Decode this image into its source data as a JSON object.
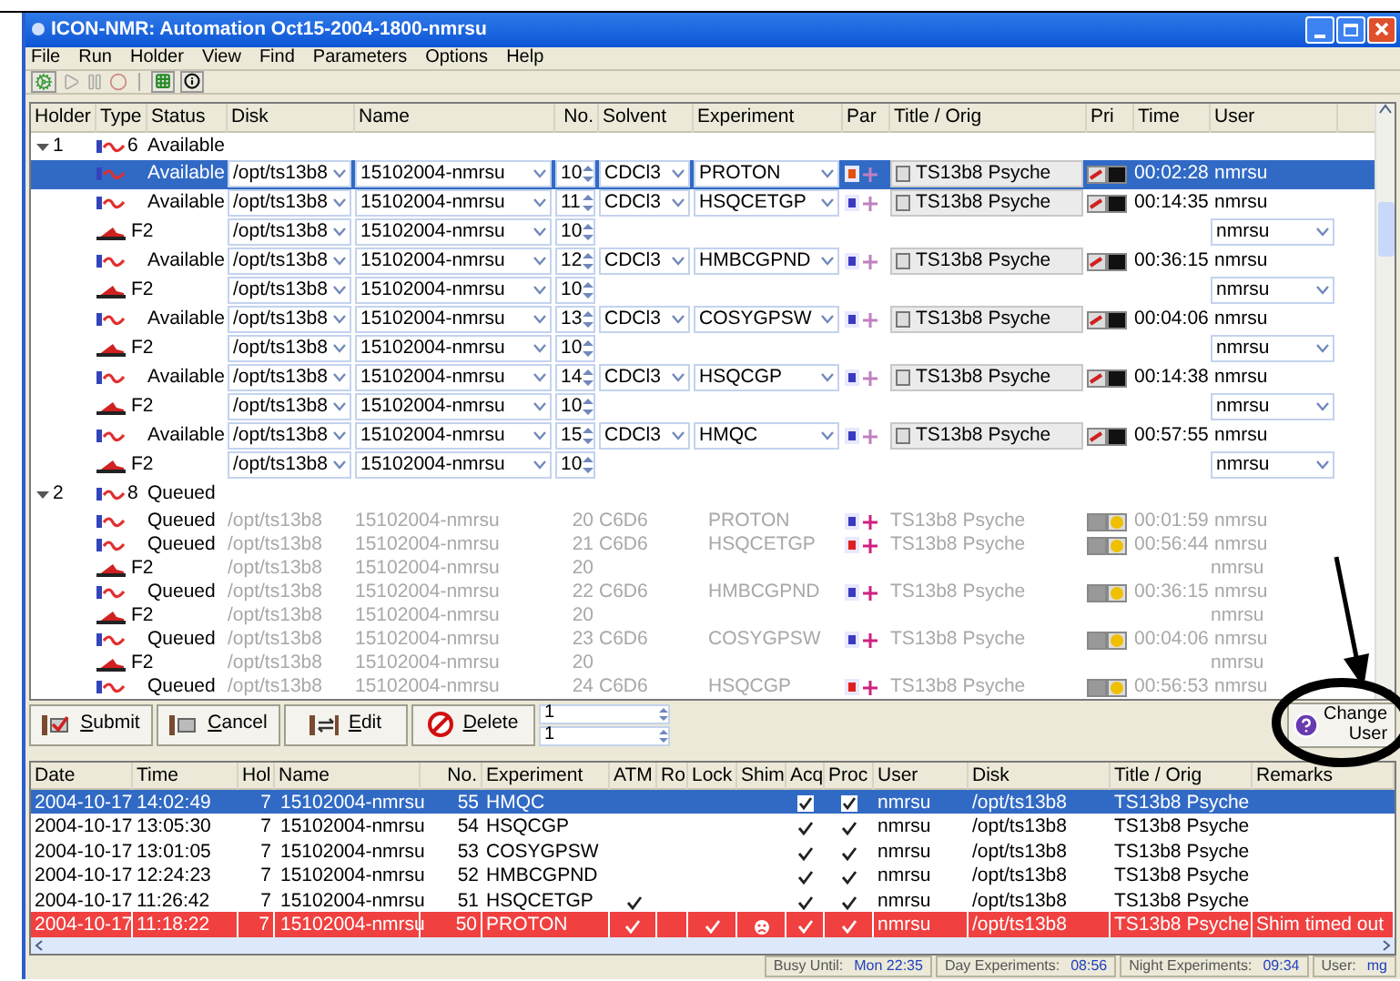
{
  "window": {
    "title": "ICON-NMR: Automation Oct15-2004-1800-nmrsu"
  },
  "menu": [
    "File",
    "Run",
    "Holder",
    "View",
    "Find",
    "Parameters",
    "Options",
    "Help"
  ],
  "queue": {
    "columns": [
      "Holder",
      "Type",
      "Status",
      "Disk",
      "Name",
      "No.",
      "Solvent",
      "Experiment",
      "Par",
      "Title / Orig",
      "Pri",
      "Time",
      "User"
    ],
    "groups": [
      {
        "holder": "1",
        "count": "6",
        "status": "Available",
        "expanded": true,
        "children": [
          {
            "kind": "experiment",
            "editable": true,
            "selected": true,
            "status": "Available",
            "disk": "/opt/ts13b8",
            "name": "15102004-nmrsu",
            "no": "10",
            "solvent": "CDCl3",
            "experiment": "PROTON",
            "color": "#e05010",
            "title": "TS13b8 Psyche",
            "time": "00:02:28",
            "user": "nmrsu"
          },
          {
            "kind": "experiment",
            "editable": true,
            "selected": false,
            "status": "Available",
            "disk": "/opt/ts13b8",
            "name": "15102004-nmrsu",
            "no": "11",
            "solvent": "CDCl3",
            "experiment": "HSQCETGP",
            "color": "#3a3ac0",
            "title": "TS13b8 Psyche",
            "time": "00:14:35",
            "user": "nmrsu"
          },
          {
            "kind": "parameter",
            "editable": true,
            "selected": false,
            "label": "F2",
            "disk": "/opt/ts13b8",
            "name": "15102004-nmrsu",
            "no": "10",
            "user": "nmrsu"
          },
          {
            "kind": "experiment",
            "editable": true,
            "selected": false,
            "status": "Available",
            "disk": "/opt/ts13b8",
            "name": "15102004-nmrsu",
            "no": "12",
            "solvent": "CDCl3",
            "experiment": "HMBCGPND",
            "color": "#3a3ac0",
            "title": "TS13b8 Psyche",
            "time": "00:36:15",
            "user": "nmrsu"
          },
          {
            "kind": "parameter",
            "editable": true,
            "selected": false,
            "label": "F2",
            "disk": "/opt/ts13b8",
            "name": "15102004-nmrsu",
            "no": "10",
            "user": "nmrsu"
          },
          {
            "kind": "experiment",
            "editable": true,
            "selected": false,
            "status": "Available",
            "disk": "/opt/ts13b8",
            "name": "15102004-nmrsu",
            "no": "13",
            "solvent": "CDCl3",
            "experiment": "COSYGPSW",
            "color": "#3a3ac0",
            "title": "TS13b8 Psyche",
            "time": "00:04:06",
            "user": "nmrsu"
          },
          {
            "kind": "parameter",
            "editable": true,
            "selected": false,
            "label": "F2",
            "disk": "/opt/ts13b8",
            "name": "15102004-nmrsu",
            "no": "10",
            "user": "nmrsu"
          },
          {
            "kind": "experiment",
            "editable": true,
            "selected": false,
            "status": "Available",
            "disk": "/opt/ts13b8",
            "name": "15102004-nmrsu",
            "no": "14",
            "solvent": "CDCl3",
            "experiment": "HSQCGP",
            "color": "#3a3ac0",
            "title": "TS13b8 Psyche",
            "time": "00:14:38",
            "user": "nmrsu"
          },
          {
            "kind": "parameter",
            "editable": true,
            "selected": false,
            "label": "F2",
            "disk": "/opt/ts13b8",
            "name": "15102004-nmrsu",
            "no": "10",
            "user": "nmrsu"
          },
          {
            "kind": "experiment",
            "editable": true,
            "selected": false,
            "status": "Available",
            "disk": "/opt/ts13b8",
            "name": "15102004-nmrsu",
            "no": "15",
            "solvent": "CDCl3",
            "experiment": "HMQC",
            "color": "#3a3ac0",
            "title": "TS13b8 Psyche",
            "time": "00:57:55",
            "user": "nmrsu"
          },
          {
            "kind": "parameter",
            "editable": true,
            "selected": false,
            "label": "F2",
            "disk": "/opt/ts13b8",
            "name": "15102004-nmrsu",
            "no": "10",
            "user": "nmrsu"
          }
        ]
      },
      {
        "holder": "2",
        "count": "8",
        "status": "Queued",
        "expanded": true,
        "children": [
          {
            "kind": "experiment",
            "editable": false,
            "selected": false,
            "status": "Queued",
            "disk": "/opt/ts13b8",
            "name": "15102004-nmrsu",
            "no": "20",
            "solvent": "C6D6",
            "experiment": "PROTON",
            "color": "#3a3ac0",
            "title": "TS13b8 Psyche",
            "time": "00:01:59",
            "user": "nmrsu"
          },
          {
            "kind": "experiment",
            "editable": false,
            "selected": false,
            "status": "Queued",
            "disk": "/opt/ts13b8",
            "name": "15102004-nmrsu",
            "no": "21",
            "solvent": "C6D6",
            "experiment": "HSQCETGP",
            "color": "#e02020",
            "title": "TS13b8 Psyche",
            "time": "00:56:44",
            "user": "nmrsu"
          },
          {
            "kind": "parameter",
            "editable": false,
            "selected": false,
            "label": "F2",
            "disk": "/opt/ts13b8",
            "name": "15102004-nmrsu",
            "no": "20",
            "user": "nmrsu"
          },
          {
            "kind": "experiment",
            "editable": false,
            "selected": false,
            "status": "Queued",
            "disk": "/opt/ts13b8",
            "name": "15102004-nmrsu",
            "no": "22",
            "solvent": "C6D6",
            "experiment": "HMBCGPND",
            "color": "#3a3ac0",
            "title": "TS13b8 Psyche",
            "time": "00:36:15",
            "user": "nmrsu"
          },
          {
            "kind": "parameter",
            "editable": false,
            "selected": false,
            "label": "F2",
            "disk": "/opt/ts13b8",
            "name": "15102004-nmrsu",
            "no": "20",
            "user": "nmrsu"
          },
          {
            "kind": "experiment",
            "editable": false,
            "selected": false,
            "status": "Queued",
            "disk": "/opt/ts13b8",
            "name": "15102004-nmrsu",
            "no": "23",
            "solvent": "C6D6",
            "experiment": "COSYGPSW",
            "color": "#3a3ac0",
            "title": "TS13b8 Psyche",
            "time": "00:04:06",
            "user": "nmrsu"
          },
          {
            "kind": "parameter",
            "editable": false,
            "selected": false,
            "label": "F2",
            "disk": "/opt/ts13b8",
            "name": "15102004-nmrsu",
            "no": "20",
            "user": "nmrsu"
          },
          {
            "kind": "experiment",
            "editable": false,
            "selected": false,
            "status": "Queued",
            "disk": "/opt/ts13b8",
            "name": "15102004-nmrsu",
            "no": "24",
            "solvent": "C6D6",
            "experiment": "HSQCGP",
            "color": "#e02020",
            "title": "TS13b8 Psyche",
            "time": "00:56:53",
            "user": "nmrsu"
          }
        ]
      }
    ]
  },
  "buttons": [
    "Submit",
    "Cancel",
    "Edit",
    "Delete"
  ],
  "spinners": [
    "1",
    "1"
  ],
  "change_user": {
    "line1": "Change",
    "line2": "User"
  },
  "history": {
    "columns": [
      "Date",
      "Time",
      "Hol",
      "Name",
      "No.",
      "Experiment",
      "ATM",
      "Ro",
      "Lock",
      "Shim",
      "Acq",
      "Proc",
      "User",
      "Disk",
      "Title / Orig",
      "Remarks"
    ],
    "rows": [
      {
        "date": "2004-10-17",
        "time": "14:02:49",
        "holder": "7",
        "name": "15102004-nmrsu",
        "no": "55",
        "experiment": "HMQC",
        "atm": false,
        "ro": false,
        "lock": false,
        "shim_failed": false,
        "acq": true,
        "proc": true,
        "user": "nmrsu",
        "disk": "/opt/ts13b8",
        "title": "TS13b8 Psyche",
        "selected": true,
        "error": false
      },
      {
        "date": "2004-10-17",
        "time": "13:05:30",
        "holder": "7",
        "name": "15102004-nmrsu",
        "no": "54",
        "experiment": "HSQCGP",
        "atm": false,
        "ro": false,
        "lock": false,
        "shim_failed": false,
        "acq": true,
        "proc": true,
        "user": "nmrsu",
        "disk": "/opt/ts13b8",
        "title": "TS13b8 Psyche",
        "selected": false,
        "error": false
      },
      {
        "date": "2004-10-17",
        "time": "13:01:05",
        "holder": "7",
        "name": "15102004-nmrsu",
        "no": "53",
        "experiment": "COSYGPSW",
        "atm": false,
        "ro": false,
        "lock": false,
        "shim_failed": false,
        "acq": true,
        "proc": true,
        "user": "nmrsu",
        "disk": "/opt/ts13b8",
        "title": "TS13b8 Psyche",
        "selected": false,
        "error": false
      },
      {
        "date": "2004-10-17",
        "time": "12:24:23",
        "holder": "7",
        "name": "15102004-nmrsu",
        "no": "52",
        "experiment": "HMBCGPND",
        "atm": false,
        "ro": false,
        "lock": false,
        "shim_failed": false,
        "acq": true,
        "proc": true,
        "user": "nmrsu",
        "disk": "/opt/ts13b8",
        "title": "TS13b8 Psyche",
        "selected": false,
        "error": false
      },
      {
        "date": "2004-10-17",
        "time": "11:26:42",
        "holder": "7",
        "name": "15102004-nmrsu",
        "no": "51",
        "experiment": "HSQCETGP",
        "atm": true,
        "ro": false,
        "lock": false,
        "shim_failed": false,
        "acq": true,
        "proc": true,
        "user": "nmrsu",
        "disk": "/opt/ts13b8",
        "title": "TS13b8 Psyche",
        "selected": false,
        "error": false
      },
      {
        "date": "2004-10-17",
        "time": "11:18:22",
        "holder": "7",
        "name": "15102004-nmrsu",
        "no": "50",
        "experiment": "PROTON",
        "atm": true,
        "ro": false,
        "lock": true,
        "shim_failed": true,
        "acq": true,
        "proc": true,
        "user": "nmrsu",
        "disk": "/opt/ts13b8",
        "title": "TS13b8 Psyche",
        "remarks": "Shim timed out",
        "selected": false,
        "error": true
      }
    ]
  },
  "status_bar": [
    {
      "label": "Busy Until:",
      "value": "Mon 22:35"
    },
    {
      "label": "Day Experiments:",
      "value": "08:56"
    },
    {
      "label": "Night Experiments:",
      "value": "09:34"
    },
    {
      "label": "User:",
      "value": "mg"
    }
  ]
}
